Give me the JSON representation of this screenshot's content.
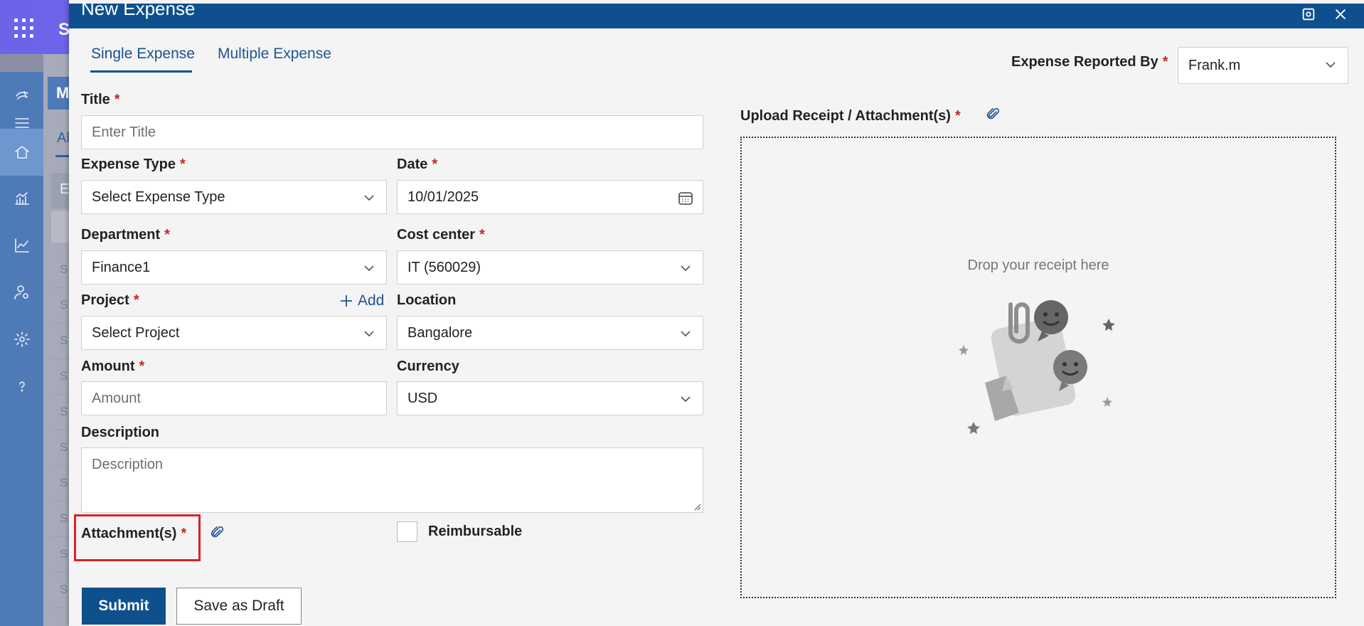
{
  "background": {
    "app_title": "S",
    "header_text": "M",
    "tab_text": "Al",
    "column_header": "E",
    "search_text": "S",
    "row_texts": [
      "S",
      "S",
      "S",
      "S",
      "S",
      "S",
      "S",
      "S",
      "S",
      "S"
    ],
    "accent_color": "#6b63e8",
    "sidebar_icons": [
      "brand-logo-icon",
      "menu-icon",
      "home-icon",
      "analytics-icon",
      "trend-icon",
      "user-settings-icon",
      "gear-icon",
      "help-icon"
    ]
  },
  "modal": {
    "title": "New Expense",
    "header_color": "#0e508e",
    "tabs": [
      {
        "label": "Single Expense",
        "active": true
      },
      {
        "label": "Multiple Expense",
        "active": false
      }
    ],
    "reported_by": {
      "label": "Expense Reported By",
      "value": "Frank.m"
    }
  },
  "form": {
    "title": {
      "label": "Title",
      "placeholder": "Enter Title"
    },
    "expense_type": {
      "label": "Expense Type",
      "value": "Select Expense Type"
    },
    "date": {
      "label": "Date",
      "value": "10/01/2025"
    },
    "department": {
      "label": "Department",
      "value": "Finance1"
    },
    "cost_center": {
      "label": "Cost center",
      "value": "IT (560029)"
    },
    "project": {
      "label": "Project",
      "value": "Select Project",
      "add_label": "Add"
    },
    "location": {
      "label": "Location",
      "value": "Bangalore"
    },
    "amount": {
      "label": "Amount",
      "placeholder": "Amount"
    },
    "currency": {
      "label": "Currency",
      "value": "USD"
    },
    "description": {
      "label": "Description",
      "placeholder": "Description"
    },
    "attachments": {
      "label": "Attachment(s)"
    },
    "reimbursable": {
      "label": "Reimbursable",
      "checked": false
    },
    "required_marker": "*"
  },
  "upload": {
    "label": "Upload Receipt / Attachment(s)",
    "drop_text": "Drop your receipt here"
  },
  "actions": {
    "submit_label": "Submit",
    "draft_label": "Save as Draft"
  }
}
